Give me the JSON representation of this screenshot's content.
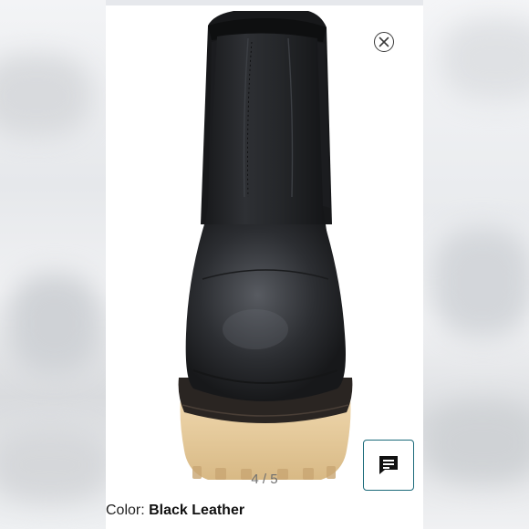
{
  "viewer": {
    "image_alt": "Black leather chelsea boot with tan lug sole, front view",
    "counter": "4 / 5"
  },
  "product": {
    "color_label": "Color:",
    "color_value": "Black Leather"
  },
  "icons": {
    "close": "close-icon",
    "chat": "chat-icon"
  },
  "colors": {
    "accent": "#1b6a7a",
    "boot": "#222326",
    "sole": "#e6c99a"
  }
}
